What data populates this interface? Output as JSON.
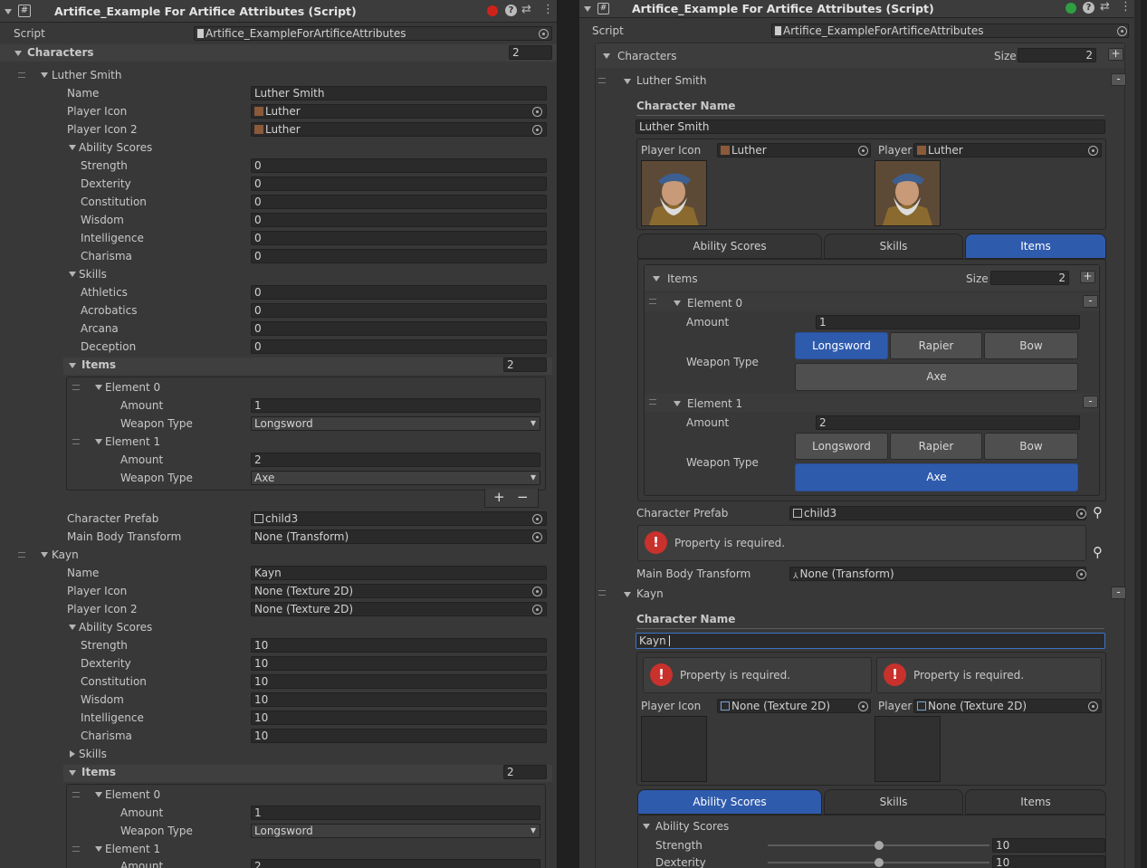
{
  "left": {
    "title": "Artifice_Example For Artifice Attributes (Script)",
    "script_label": "Script",
    "script_value": "Artifice_ExampleForArtificeAttributes",
    "characters_label": "Characters",
    "characters_size": "2",
    "c1": {
      "header": "Luther Smith",
      "name_label": "Name",
      "name_value": "Luther Smith",
      "icon_label": "Player Icon",
      "icon_value": "Luther",
      "icon2_label": "Player Icon 2",
      "icon2_value": "Luther",
      "ability_label": "Ability Scores",
      "abilities": [
        {
          "l": "Strength",
          "v": "0"
        },
        {
          "l": "Dexterity",
          "v": "0"
        },
        {
          "l": "Constitution",
          "v": "0"
        },
        {
          "l": "Wisdom",
          "v": "0"
        },
        {
          "l": "Intelligence",
          "v": "0"
        },
        {
          "l": "Charisma",
          "v": "0"
        }
      ],
      "skills_label": "Skills",
      "skills": [
        {
          "l": "Athletics",
          "v": "0"
        },
        {
          "l": "Acrobatics",
          "v": "0"
        },
        {
          "l": "Arcana",
          "v": "0"
        },
        {
          "l": "Deception",
          "v": "0"
        }
      ],
      "items_label": "Items",
      "items_size": "2",
      "e0": {
        "label": "Element 0",
        "amount_label": "Amount",
        "amount": "1",
        "wt_label": "Weapon Type",
        "wt": "Longsword"
      },
      "e1": {
        "label": "Element 1",
        "amount_label": "Amount",
        "amount": "2",
        "wt_label": "Weapon Type",
        "wt": "Axe"
      },
      "plus": "+",
      "minus": "−",
      "prefab_label": "Character Prefab",
      "prefab_value": "child3",
      "body_label": "Main Body Transform",
      "body_value": "None (Transform)"
    },
    "c2": {
      "header": "Kayn",
      "name_label": "Name",
      "name_value": "Kayn",
      "icon_label": "Player Icon",
      "icon_value": "None (Texture 2D)",
      "icon2_label": "Player Icon 2",
      "icon2_value": "None (Texture 2D)",
      "ability_label": "Ability Scores",
      "abilities": [
        {
          "l": "Strength",
          "v": "10"
        },
        {
          "l": "Dexterity",
          "v": "10"
        },
        {
          "l": "Constitution",
          "v": "10"
        },
        {
          "l": "Wisdom",
          "v": "10"
        },
        {
          "l": "Intelligence",
          "v": "10"
        },
        {
          "l": "Charisma",
          "v": "10"
        }
      ],
      "skills_label": "Skills",
      "items_label": "Items",
      "items_size": "2",
      "e0": {
        "label": "Element 0",
        "amount_label": "Amount",
        "amount": "1",
        "wt_label": "Weapon Type",
        "wt": "Longsword"
      },
      "e1": {
        "label": "Element 1",
        "amount_label": "Amount",
        "amount": "2"
      }
    }
  },
  "right": {
    "title": "Artifice_Example For Artifice Attributes (Script)",
    "script_label": "Script",
    "script_value": "Artifice_ExampleForArtificeAttributes",
    "characters_label": "Characters",
    "size_label": "Size",
    "characters_size": "2",
    "c1": {
      "header": "Luther Smith",
      "cname_label": "Character Name",
      "cname_value": "Luther Smith",
      "icon_label": "Player Icon",
      "icon_value": "Luther",
      "icon2_label": "Player",
      "icon2_value": "Luther",
      "tabs": [
        "Ability Scores",
        "Skills",
        "Items"
      ],
      "items_label": "Items",
      "size_label": "Size",
      "items_size": "2",
      "e0": {
        "label": "Element 0",
        "amount_label": "Amount",
        "amount": "1",
        "wt_label": "Weapon Type"
      },
      "e1": {
        "label": "Element 1",
        "amount_label": "Amount",
        "amount": "2",
        "wt_label": "Weapon Type"
      },
      "weapons": [
        "Longsword",
        "Rapier",
        "Bow",
        "Axe"
      ],
      "prefab_label": "Character Prefab",
      "prefab_value": "child3",
      "required": "Property is required.",
      "body_label": "Main Body Transform",
      "body_value": "None (Transform)"
    },
    "c2": {
      "header": "Kayn",
      "cname_label": "Character Name",
      "cname_value": "Kayn",
      "required": "Property is required.",
      "icon_label": "Player Icon",
      "icon_value": "None (Texture 2D)",
      "icon2_label": "Player",
      "icon2_value": "None (Texture 2D)",
      "tabs": [
        "Ability Scores",
        "Skills",
        "Items"
      ],
      "ability_label": "Ability Scores",
      "strength_label": "Strength",
      "strength": "10",
      "strength_fraction": 0.5,
      "dex_label": "Dexterity",
      "dex": "10",
      "dex_fraction": 0.5
    }
  },
  "colors": {
    "accent": "#2f5bad",
    "error": "#c8312c",
    "red_dot": "#d0221b",
    "green_dot": "#2ea043"
  }
}
